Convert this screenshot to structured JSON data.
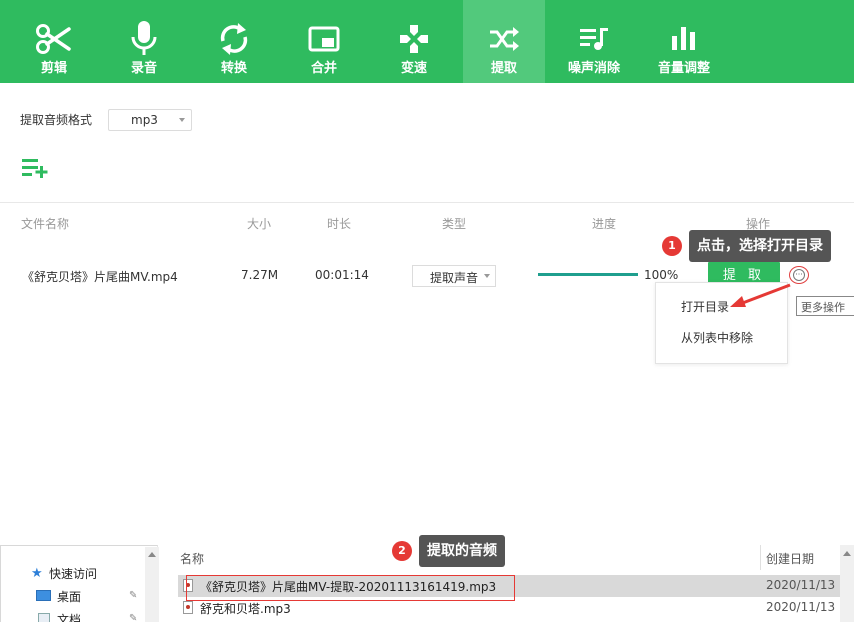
{
  "colors": {
    "brand": "#2fbb5f",
    "toolbar_active": "#52c97c",
    "progress": "#1f9f8e",
    "annotation": "#e53935"
  },
  "toolbar": {
    "items": [
      {
        "label": "剪辑",
        "icon": "scissors-icon"
      },
      {
        "label": "录音",
        "icon": "microphone-icon"
      },
      {
        "label": "转换",
        "icon": "convert-icon"
      },
      {
        "label": "合并",
        "icon": "merge-icon"
      },
      {
        "label": "变速",
        "icon": "speed-icon"
      },
      {
        "label": "提取",
        "icon": "shuffle-icon",
        "active": true
      },
      {
        "label": "噪声消除",
        "icon": "noise-removal-icon"
      },
      {
        "label": "音量调整",
        "icon": "volume-bars-icon"
      }
    ]
  },
  "format": {
    "label": "提取音频格式",
    "value": "mp3"
  },
  "table": {
    "headers": {
      "name": "文件名称",
      "size": "大小",
      "duration": "时长",
      "type": "类型",
      "progress": "进度",
      "action": "操作"
    },
    "row": {
      "name": "《舒克贝塔》片尾曲MV.mp4",
      "size": "7.27M",
      "duration": "00:01:14",
      "type": "提取声音",
      "progress_percent": 100,
      "progress_label": "100%",
      "action": "提 取"
    }
  },
  "more_menu": {
    "items": [
      "打开目录",
      "从列表中移除"
    ],
    "tooltip": "更多操作"
  },
  "annotations": {
    "step1": {
      "num": "1",
      "text": "点击，选择打开目录"
    },
    "step2": {
      "num": "2",
      "text": "提取的音频"
    }
  },
  "explorer": {
    "nav": [
      {
        "label": "快速访问",
        "icon": "star-icon"
      },
      {
        "label": "桌面",
        "icon": "desktop-icon"
      },
      {
        "label": "文档",
        "icon": "document-icon"
      }
    ],
    "columns": {
      "name": "名称",
      "date": "创建日期"
    },
    "files": [
      {
        "name": "《舒克贝塔》片尾曲MV-提取-20201113161419.mp3",
        "date": "2020/11/13"
      },
      {
        "name": "舒克和贝塔.mp3",
        "date": "2020/11/13"
      }
    ]
  }
}
